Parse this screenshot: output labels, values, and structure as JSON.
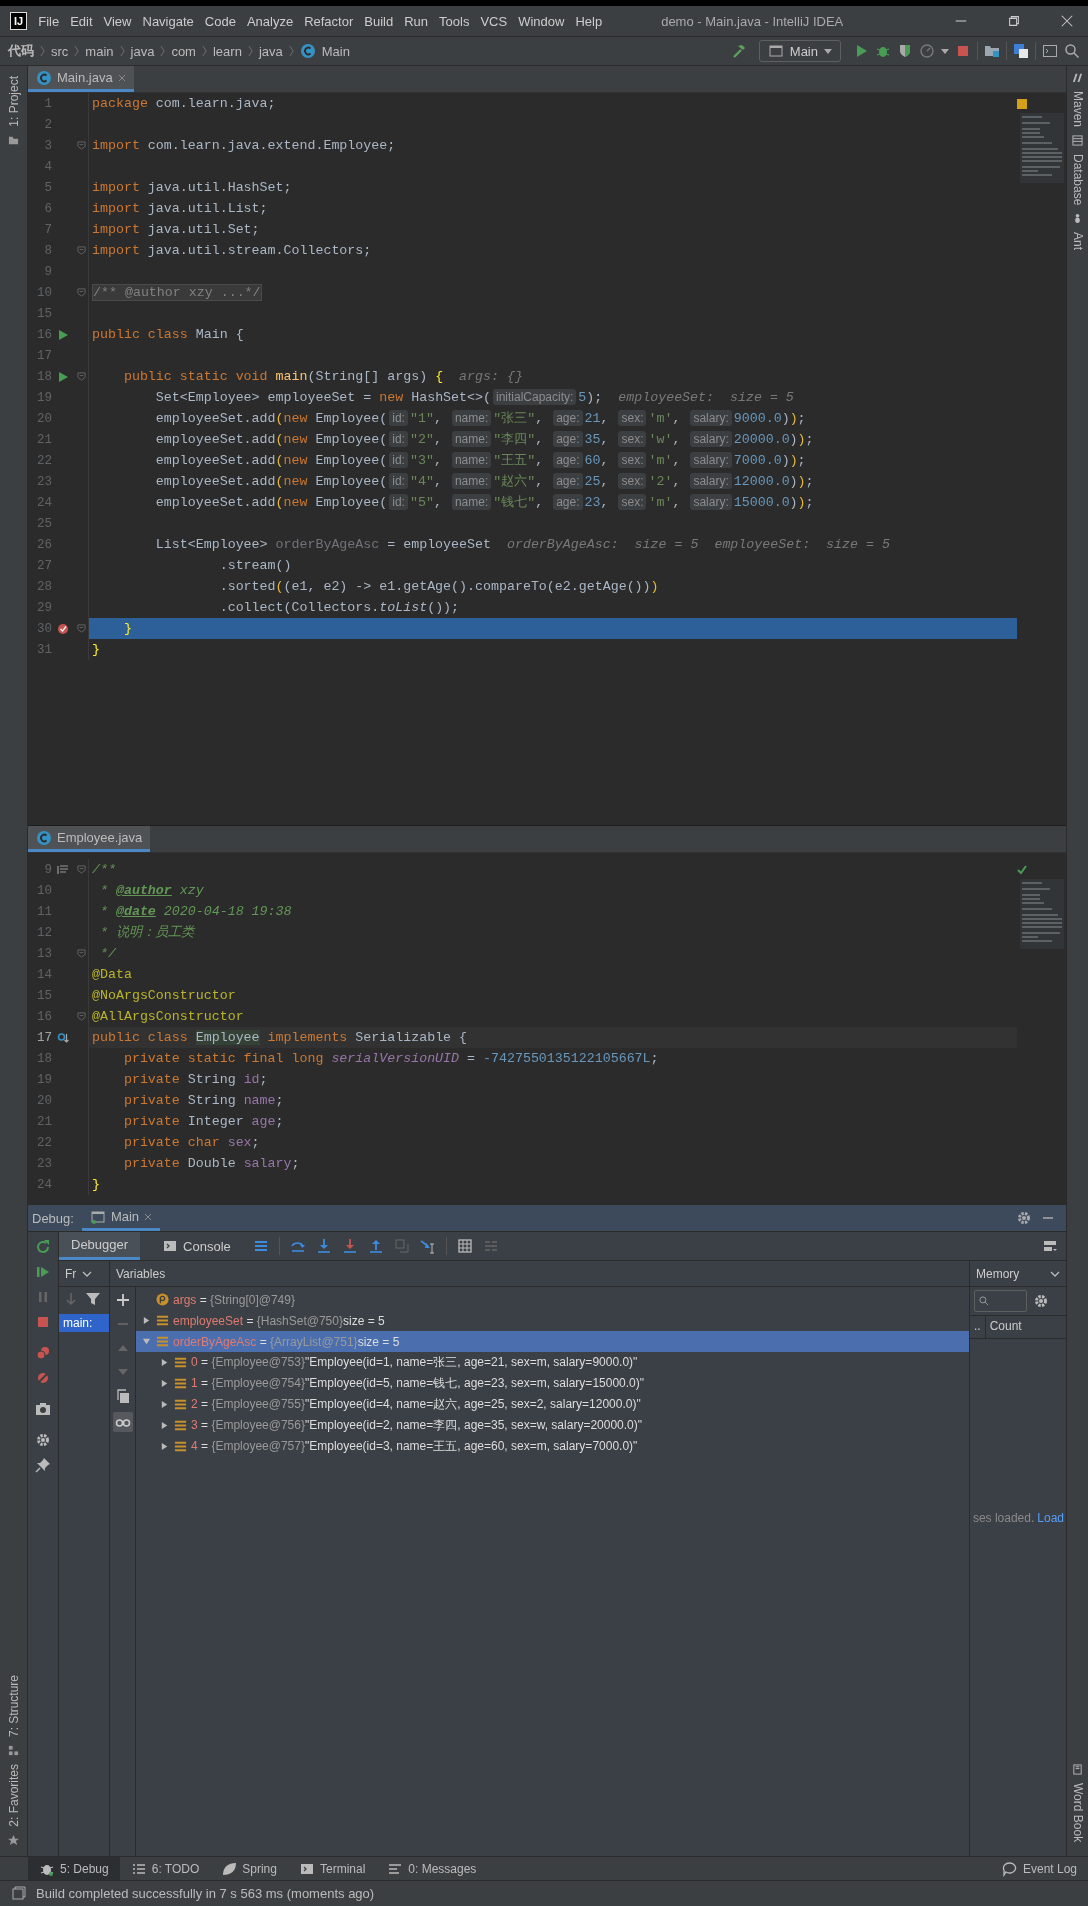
{
  "window": {
    "logo": "IJ",
    "title": "demo - Main.java - IntelliJ IDEA"
  },
  "menu": [
    "File",
    "Edit",
    "View",
    "Navigate",
    "Code",
    "Analyze",
    "Refactor",
    "Build",
    "Run",
    "Tools",
    "VCS",
    "Window",
    "Help"
  ],
  "breadcrumbs": [
    "代码",
    "src",
    "main",
    "java",
    "com",
    "learn",
    "java",
    "Main"
  ],
  "run_config": "Main",
  "left_tools": {
    "top": [
      "1: Project"
    ],
    "bottom": [
      "7: Structure",
      "2: Favorites"
    ]
  },
  "right_tools": {
    "top": [
      "Maven",
      "Database",
      "Ant"
    ],
    "bottom": [
      "Word Book"
    ]
  },
  "editors": [
    {
      "tab": "Main.java",
      "selected": true,
      "lines": [
        {
          "no": "1",
          "fold": false,
          "kind": "plain",
          "tokens": [
            {
              "kind": "kw",
              "text": "package "
            },
            {
              "kind": "txt",
              "text": "com.learn.java;"
            }
          ]
        },
        {
          "no": "2",
          "fold": false,
          "kind": "plain"
        },
        {
          "no": "3",
          "fold": true,
          "kind": "plain",
          "tokens": [
            {
              "kind": "kw",
              "text": "import "
            },
            {
              "kind": "txt",
              "text": "com.learn.java.extend.Employee;"
            }
          ]
        },
        {
          "no": "4",
          "fold": false,
          "kind": "plain"
        },
        {
          "no": "5",
          "fold": false,
          "kind": "plain",
          "tokens": [
            {
              "kind": "kw",
              "text": "import "
            },
            {
              "kind": "txt",
              "text": "java.util.HashSet;"
            }
          ]
        },
        {
          "no": "6",
          "fold": false,
          "kind": "plain",
          "tokens": [
            {
              "kind": "kw",
              "text": "import "
            },
            {
              "kind": "txt",
              "text": "java.util.List;"
            }
          ]
        },
        {
          "no": "7",
          "fold": false,
          "kind": "plain",
          "tokens": [
            {
              "kind": "kw",
              "text": "import "
            },
            {
              "kind": "txt",
              "text": "java.util.Set;"
            }
          ]
        },
        {
          "no": "8",
          "fold": true,
          "kind": "plain",
          "tokens": [
            {
              "kind": "kw",
              "text": "import "
            },
            {
              "kind": "txt",
              "text": "java.util.stream.Collectors;"
            }
          ]
        },
        {
          "no": "9",
          "fold": false,
          "kind": "plain"
        },
        {
          "no": "10",
          "fold": true,
          "kind": "plain",
          "tokens": [
            {
              "kind": "folded",
              "text": "/** @author xzy ...*/"
            }
          ]
        },
        {
          "no": "15",
          "fold": false,
          "kind": "plain"
        },
        {
          "no": "16",
          "gutter": {
            "kind": "run"
          },
          "fold": false,
          "kind": "plain",
          "tokens": [
            {
              "kind": "kw",
              "text": "public class "
            },
            {
              "kind": "txt",
              "text": "Main {"
            }
          ]
        },
        {
          "no": "17",
          "fold": false,
          "kind": "plain"
        },
        {
          "no": "18",
          "gutter": {
            "kind": "run"
          },
          "fold": true,
          "kind": "plain",
          "tokens": [
            {
              "kind": "kw",
              "text": "    public static void "
            },
            {
              "kind": "method",
              "text": "main"
            },
            {
              "kind": "txt",
              "text": "(String[] args) "
            },
            {
              "kind": "brace",
              "text": "{"
            },
            {
              "kind": "dbg",
              "text": "  args: {}"
            }
          ]
        },
        {
          "no": "19",
          "fold": false,
          "kind": "plain",
          "tokens": [
            {
              "kind": "txt",
              "text": "        Set<Employee> employeeSet = "
            },
            {
              "kind": "kw",
              "text": "new "
            },
            {
              "kind": "txt",
              "text": "HashSet<>("
            },
            {
              "kind": "hint",
              "text": "initialCapacity:"
            },
            {
              "kind": "num",
              "text": "5"
            },
            {
              "kind": "txt",
              "text": ");"
            },
            {
              "kind": "dbg",
              "text": "  employeeSet:  size = 5"
            }
          ]
        },
        {
          "no": "20",
          "fold": false,
          "kind": "plain",
          "tokens": [
            {
              "kind": "txt",
              "text": "        employeeSet.add"
            },
            {
              "kind": "paren",
              "text": "("
            },
            {
              "kind": "kw",
              "text": "new "
            },
            {
              "kind": "txt",
              "text": "Employee("
            },
            {
              "kind": "hint",
              "text": "id:"
            },
            {
              "kind": "str",
              "text": "\"1\""
            },
            {
              "kind": "txt",
              "text": ", "
            },
            {
              "kind": "hint",
              "text": "name:"
            },
            {
              "kind": "str",
              "text": "\"张三\""
            },
            {
              "kind": "txt",
              "text": ", "
            },
            {
              "kind": "hint",
              "text": "age:"
            },
            {
              "kind": "num",
              "text": "21"
            },
            {
              "kind": "txt",
              "text": ", "
            },
            {
              "kind": "hint",
              "text": "sex:"
            },
            {
              "kind": "str",
              "text": "'m'"
            },
            {
              "kind": "txt",
              "text": ", "
            },
            {
              "kind": "hint",
              "text": "salary:"
            },
            {
              "kind": "num",
              "text": "9000.0"
            },
            {
              "kind": "txt",
              "text": ")"
            },
            {
              "kind": "paren",
              "text": ")"
            },
            {
              "kind": "txt",
              "text": ";"
            }
          ]
        },
        {
          "no": "21",
          "fold": false,
          "kind": "plain",
          "tokens": [
            {
              "kind": "txt",
              "text": "        employeeSet.add"
            },
            {
              "kind": "paren",
              "text": "("
            },
            {
              "kind": "kw",
              "text": "new "
            },
            {
              "kind": "txt",
              "text": "Employee("
            },
            {
              "kind": "hint",
              "text": "id:"
            },
            {
              "kind": "str",
              "text": "\"2\""
            },
            {
              "kind": "txt",
              "text": ", "
            },
            {
              "kind": "hint",
              "text": "name:"
            },
            {
              "kind": "str",
              "text": "\"李四\""
            },
            {
              "kind": "txt",
              "text": ", "
            },
            {
              "kind": "hint",
              "text": "age:"
            },
            {
              "kind": "num",
              "text": "35"
            },
            {
              "kind": "txt",
              "text": ", "
            },
            {
              "kind": "hint",
              "text": "sex:"
            },
            {
              "kind": "str",
              "text": "'w'"
            },
            {
              "kind": "txt",
              "text": ", "
            },
            {
              "kind": "hint",
              "text": "salary:"
            },
            {
              "kind": "num",
              "text": "20000.0"
            },
            {
              "kind": "txt",
              "text": ")"
            },
            {
              "kind": "paren",
              "text": ")"
            },
            {
              "kind": "txt",
              "text": ";"
            }
          ]
        },
        {
          "no": "22",
          "fold": false,
          "kind": "plain",
          "tokens": [
            {
              "kind": "txt",
              "text": "        employeeSet.add"
            },
            {
              "kind": "paren",
              "text": "("
            },
            {
              "kind": "kw",
              "text": "new "
            },
            {
              "kind": "txt",
              "text": "Employee("
            },
            {
              "kind": "hint",
              "text": "id:"
            },
            {
              "kind": "str",
              "text": "\"3\""
            },
            {
              "kind": "txt",
              "text": ", "
            },
            {
              "kind": "hint",
              "text": "name:"
            },
            {
              "kind": "str",
              "text": "\"王五\""
            },
            {
              "kind": "txt",
              "text": ", "
            },
            {
              "kind": "hint",
              "text": "age:"
            },
            {
              "kind": "num",
              "text": "60"
            },
            {
              "kind": "txt",
              "text": ", "
            },
            {
              "kind": "hint",
              "text": "sex:"
            },
            {
              "kind": "str",
              "text": "'m'"
            },
            {
              "kind": "txt",
              "text": ", "
            },
            {
              "kind": "hint",
              "text": "salary:"
            },
            {
              "kind": "num",
              "text": "7000.0"
            },
            {
              "kind": "txt",
              "text": ")"
            },
            {
              "kind": "paren",
              "text": ")"
            },
            {
              "kind": "txt",
              "text": ";"
            }
          ]
        },
        {
          "no": "23",
          "fold": false,
          "kind": "plain",
          "tokens": [
            {
              "kind": "txt",
              "text": "        employeeSet.add"
            },
            {
              "kind": "paren",
              "text": "("
            },
            {
              "kind": "kw",
              "text": "new "
            },
            {
              "kind": "txt",
              "text": "Employee("
            },
            {
              "kind": "hint",
              "text": "id:"
            },
            {
              "kind": "str",
              "text": "\"4\""
            },
            {
              "kind": "txt",
              "text": ", "
            },
            {
              "kind": "hint",
              "text": "name:"
            },
            {
              "kind": "str",
              "text": "\"赵六\""
            },
            {
              "kind": "txt",
              "text": ", "
            },
            {
              "kind": "hint",
              "text": "age:"
            },
            {
              "kind": "num",
              "text": "25"
            },
            {
              "kind": "txt",
              "text": ", "
            },
            {
              "kind": "hint",
              "text": "sex:"
            },
            {
              "kind": "str",
              "text": "'2'"
            },
            {
              "kind": "txt",
              "text": ", "
            },
            {
              "kind": "hint",
              "text": "salary:"
            },
            {
              "kind": "num",
              "text": "12000.0"
            },
            {
              "kind": "txt",
              "text": ")"
            },
            {
              "kind": "paren",
              "text": ")"
            },
            {
              "kind": "txt",
              "text": ";"
            }
          ]
        },
        {
          "no": "24",
          "fold": false,
          "kind": "plain",
          "tokens": [
            {
              "kind": "txt",
              "text": "        employeeSet.add"
            },
            {
              "kind": "paren",
              "text": "("
            },
            {
              "kind": "kw",
              "text": "new "
            },
            {
              "kind": "txt",
              "text": "Employee("
            },
            {
              "kind": "hint",
              "text": "id:"
            },
            {
              "kind": "str",
              "text": "\"5\""
            },
            {
              "kind": "txt",
              "text": ", "
            },
            {
              "kind": "hint",
              "text": "name:"
            },
            {
              "kind": "str",
              "text": "\"钱七\""
            },
            {
              "kind": "txt",
              "text": ", "
            },
            {
              "kind": "hint",
              "text": "age:"
            },
            {
              "kind": "num",
              "text": "23"
            },
            {
              "kind": "txt",
              "text": ", "
            },
            {
              "kind": "hint",
              "text": "sex:"
            },
            {
              "kind": "str",
              "text": "'m'"
            },
            {
              "kind": "txt",
              "text": ", "
            },
            {
              "kind": "hint",
              "text": "salary:"
            },
            {
              "kind": "num",
              "text": "15000.0"
            },
            {
              "kind": "txt",
              "text": ")"
            },
            {
              "kind": "paren",
              "text": ")"
            },
            {
              "kind": "txt",
              "text": ";"
            }
          ]
        },
        {
          "no": "25",
          "fold": false,
          "kind": "plain"
        },
        {
          "no": "26",
          "fold": false,
          "kind": "plain",
          "tokens": [
            {
              "kind": "txt",
              "text": "        List<Employee> "
            },
            {
              "kind": "unused",
              "text": "orderByAgeAsc"
            },
            {
              "kind": "txt",
              "text": " = employeeSet"
            },
            {
              "kind": "dbg",
              "text": "  orderByAgeAsc:  size = 5  employeeSet:  size = 5"
            }
          ]
        },
        {
          "no": "27",
          "fold": false,
          "kind": "plain",
          "tokens": [
            {
              "kind": "txt",
              "text": "                .stream()"
            }
          ]
        },
        {
          "no": "28",
          "fold": false,
          "kind": "plain",
          "tokens": [
            {
              "kind": "txt",
              "text": "                .sorted"
            },
            {
              "kind": "paren",
              "text": "("
            },
            {
              "kind": "txt",
              "text": "(e1, e2) -> e1.getAge().compareTo(e2.getAge())"
            },
            {
              "kind": "paren",
              "text": ")"
            }
          ]
        },
        {
          "no": "29",
          "fold": false,
          "kind": "plain",
          "tokens": [
            {
              "kind": "txt",
              "text": "                .collect(Collectors."
            },
            {
              "kind": "ital",
              "text": "toList"
            },
            {
              "kind": "txt",
              "text": "());"
            }
          ]
        },
        {
          "no": "30",
          "gutter": {
            "kind": "breakpoint"
          },
          "fold": true,
          "kind": "execution",
          "tokens": [
            {
              "kind": "brace",
              "text": "    }"
            }
          ]
        },
        {
          "no": "31",
          "fold": false,
          "kind": "plain",
          "tokens": [
            {
              "kind": "brace",
              "text": "}"
            }
          ]
        }
      ]
    },
    {
      "tab": "Employee.java",
      "selected": true,
      "lines": [
        {
          "no": "9",
          "gutter": {
            "kind": "doc"
          },
          "fold": true,
          "kind": "plain",
          "tokens": [
            {
              "kind": "doc",
              "text": "/**"
            }
          ]
        },
        {
          "no": "10",
          "fold": false,
          "kind": "plain",
          "tokens": [
            {
              "kind": "doc",
              "text": " * "
            },
            {
              "kind": "tag",
              "text": "@author"
            },
            {
              "kind": "doc",
              "text": " xzy"
            }
          ]
        },
        {
          "no": "11",
          "fold": false,
          "kind": "plain",
          "tokens": [
            {
              "kind": "doc",
              "text": " * "
            },
            {
              "kind": "tag",
              "text": "@date"
            },
            {
              "kind": "doc",
              "text": " 2020-04-18 19:38"
            }
          ]
        },
        {
          "no": "12",
          "fold": false,
          "kind": "plain",
          "tokens": [
            {
              "kind": "doc",
              "text": " * 说明：员工类"
            }
          ]
        },
        {
          "no": "13",
          "fold": true,
          "kind": "plain",
          "tokens": [
            {
              "kind": "doc",
              "text": " */"
            }
          ]
        },
        {
          "no": "14",
          "fold": false,
          "kind": "plain",
          "tokens": [
            {
              "kind": "ann",
              "text": "@Data"
            }
          ]
        },
        {
          "no": "15",
          "fold": false,
          "kind": "plain",
          "tokens": [
            {
              "kind": "ann",
              "text": "@NoArgsConstructor"
            }
          ]
        },
        {
          "no": "16",
          "fold": true,
          "kind": "plain",
          "tokens": [
            {
              "kind": "ann",
              "text": "@AllArgsConstructor"
            }
          ]
        },
        {
          "no": "17",
          "gutter": {
            "kind": "implements"
          },
          "fold": false,
          "kind": "caret",
          "tokens": [
            {
              "kind": "kw",
              "text": "public class "
            },
            {
              "kind": "usage",
              "text": "Employee"
            },
            {
              "kind": "kw",
              "text": " implements "
            },
            {
              "kind": "txt",
              "text": "Serializable {"
            }
          ]
        },
        {
          "no": "18",
          "fold": false,
          "kind": "plain",
          "tokens": [
            {
              "kind": "kw",
              "text": "    private static final long "
            },
            {
              "kind": "sfld",
              "text": "serialVersionUID"
            },
            {
              "kind": "txt",
              "text": " = "
            },
            {
              "kind": "num",
              "text": "-7427550135122105667L"
            },
            {
              "kind": "txt",
              "text": ";"
            }
          ]
        },
        {
          "no": "19",
          "fold": false,
          "kind": "plain",
          "tokens": [
            {
              "kind": "kw",
              "text": "    private "
            },
            {
              "kind": "txt",
              "text": "String "
            },
            {
              "kind": "fld",
              "text": "id"
            },
            {
              "kind": "txt",
              "text": ";"
            }
          ]
        },
        {
          "no": "20",
          "fold": false,
          "kind": "plain",
          "tokens": [
            {
              "kind": "kw",
              "text": "    private "
            },
            {
              "kind": "txt",
              "text": "String "
            },
            {
              "kind": "fld",
              "text": "name"
            },
            {
              "kind": "txt",
              "text": ";"
            }
          ]
        },
        {
          "no": "21",
          "fold": false,
          "kind": "plain",
          "tokens": [
            {
              "kind": "kw",
              "text": "    private "
            },
            {
              "kind": "txt",
              "text": "Integer "
            },
            {
              "kind": "fld",
              "text": "age"
            },
            {
              "kind": "txt",
              "text": ";"
            }
          ]
        },
        {
          "no": "22",
          "fold": false,
          "kind": "plain",
          "tokens": [
            {
              "kind": "kw",
              "text": "    private char "
            },
            {
              "kind": "fld",
              "text": "sex"
            },
            {
              "kind": "txt",
              "text": ";"
            }
          ]
        },
        {
          "no": "23",
          "fold": false,
          "kind": "plain",
          "tokens": [
            {
              "kind": "kw",
              "text": "    private "
            },
            {
              "kind": "txt",
              "text": "Double "
            },
            {
              "kind": "fld",
              "text": "salary"
            },
            {
              "kind": "txt",
              "text": ";"
            }
          ]
        },
        {
          "no": "24",
          "fold": false,
          "kind": "plain",
          "tokens": [
            {
              "kind": "brace",
              "text": "}"
            }
          ]
        }
      ]
    }
  ],
  "debug": {
    "label": "Debug:",
    "tabs": [
      {
        "label": "Main",
        "selected": true
      }
    ],
    "view_tabs": [
      {
        "label": "Debugger",
        "selected": true
      },
      {
        "label": "Console",
        "selected": false
      }
    ],
    "frames": {
      "header": "Fr",
      "items": [
        {
          "label": "main:",
          "selected": true
        }
      ]
    },
    "variables": {
      "header": "Variables",
      "rows": [
        {
          "kind": "param",
          "name": "args",
          "sign": "=",
          "ref": "{String[0]@749}",
          "selected": false
        },
        {
          "kind": "object",
          "name": "employeeSet",
          "sign": "=",
          "ref": "{HashSet@750}",
          "value": "size = 5",
          "expanded": false,
          "selected": false
        },
        {
          "kind": "object",
          "name": "orderByAgeAsc",
          "sign": "=",
          "ref": "{ArrayList@751}",
          "value": "size = 5",
          "expanded": true,
          "selected": true,
          "children": [
            {
              "kind": "object",
              "name": "0",
              "sign": "=",
              "ref": "{Employee@753}",
              "value": "\"Employee(id=1, name=张三, age=21, sex=m, salary=9000.0)\"",
              "expanded": false,
              "selected": false
            },
            {
              "kind": "object",
              "name": "1",
              "sign": "=",
              "ref": "{Employee@754}",
              "value": "\"Employee(id=5, name=钱七, age=23, sex=m, salary=15000.0)\"",
              "expanded": false,
              "selected": false
            },
            {
              "kind": "object",
              "name": "2",
              "sign": "=",
              "ref": "{Employee@755}",
              "value": "\"Employee(id=4, name=赵六, age=25, sex=2, salary=12000.0)\"",
              "expanded": false,
              "selected": false
            },
            {
              "kind": "object",
              "name": "3",
              "sign": "=",
              "ref": "{Employee@756}",
              "value": "\"Employee(id=2, name=李四, age=35, sex=w, salary=20000.0)\"",
              "expanded": false,
              "selected": false
            },
            {
              "kind": "object",
              "name": "4",
              "sign": "=",
              "ref": "{Employee@757}",
              "value": "\"Employee(id=3, name=王五, age=60, sex=m, salary=7000.0)\"",
              "expanded": false,
              "selected": false
            }
          ]
        }
      ]
    },
    "memory": {
      "header": "Memory",
      "columns": [
        "..",
        "Count"
      ],
      "notice": "ses loaded.",
      "link": "Load"
    }
  },
  "bottom_tabs": [
    {
      "label": "5: Debug",
      "selected": true
    },
    {
      "label": "6: TODO",
      "selected": false
    },
    {
      "label": "Spring",
      "selected": false
    },
    {
      "label": "Terminal",
      "selected": false
    },
    {
      "label": "0: Messages",
      "selected": false
    }
  ],
  "event_log": "Event Log",
  "status_bar": "Build completed successfully in 7 s 563 ms (moments ago)"
}
